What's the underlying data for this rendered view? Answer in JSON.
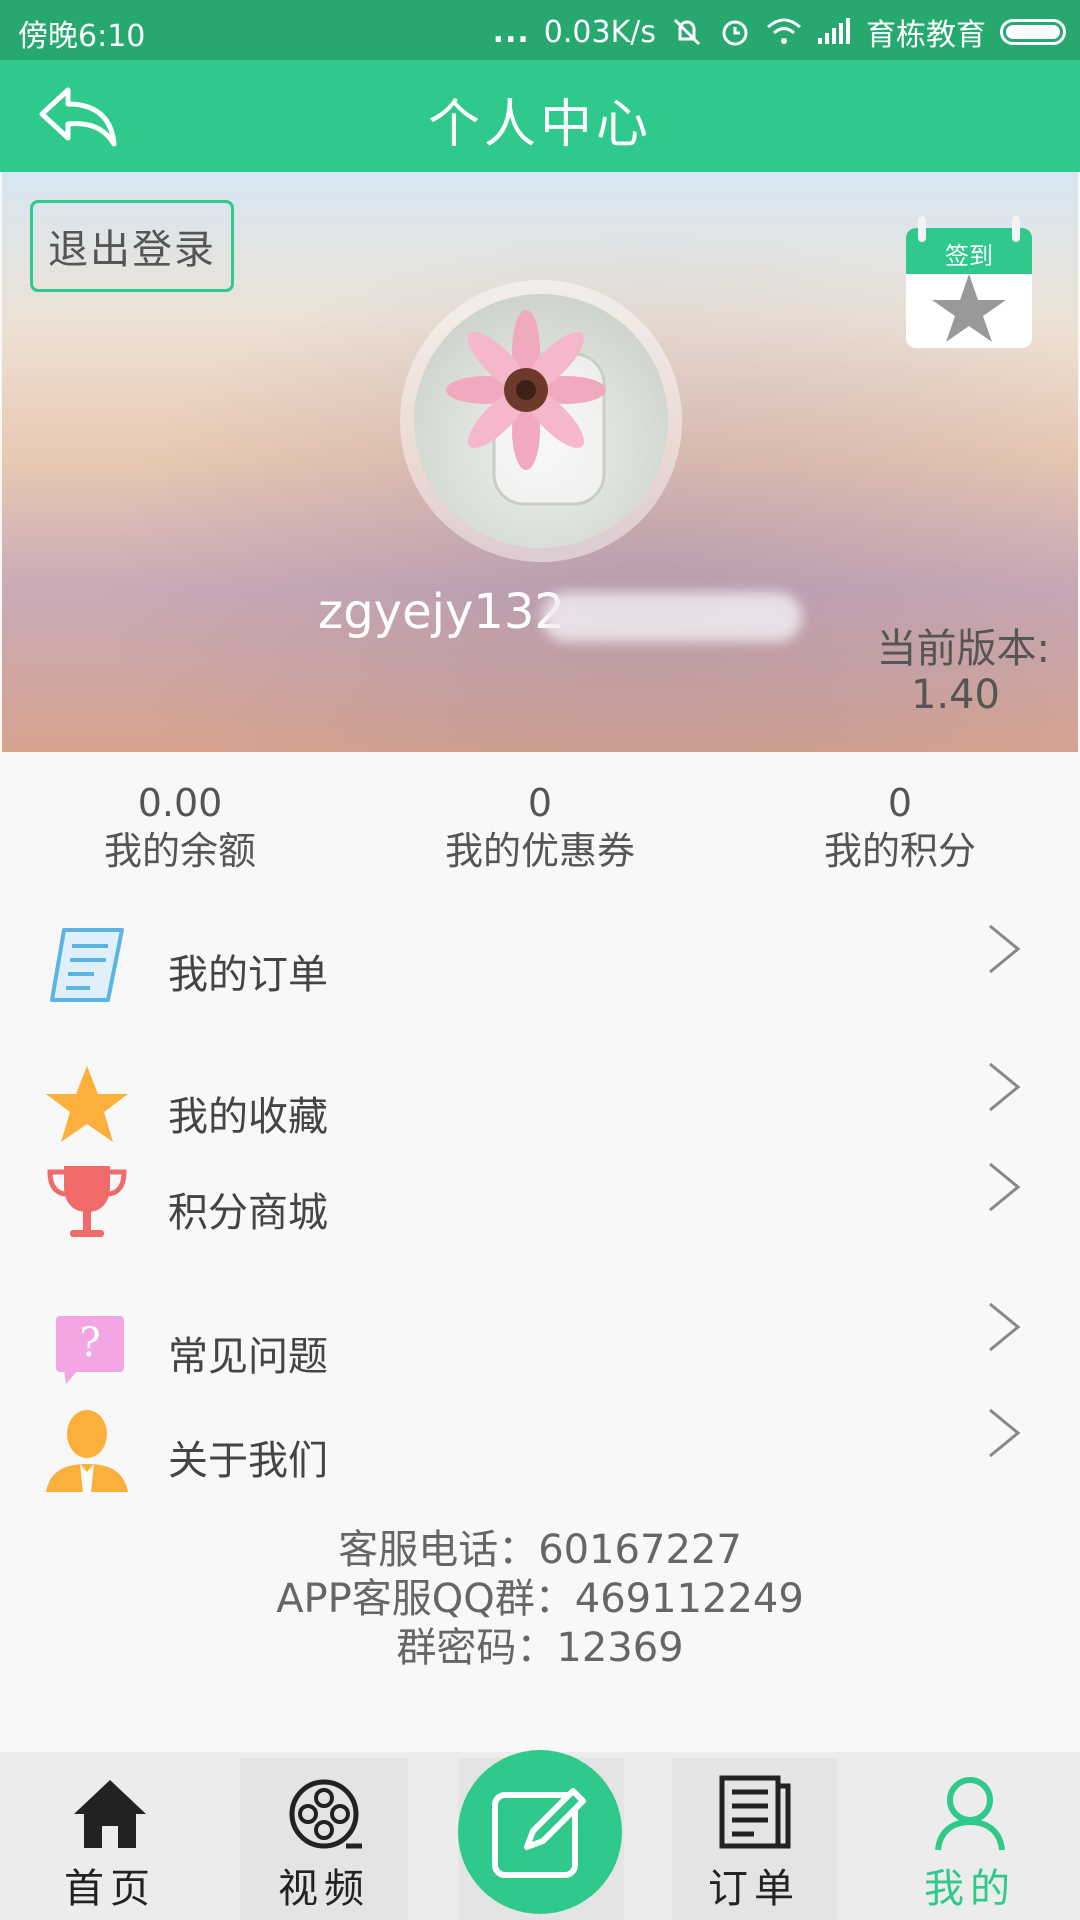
{
  "status_bar": {
    "time": "傍晚6:10",
    "dots": "...",
    "speed": "0.03K/s",
    "carrier": "育栋教育"
  },
  "header": {
    "title": "个人中心"
  },
  "profile": {
    "logout_label": "退出登录",
    "signin_label": "签到",
    "username": "zgyejy132",
    "version_label": "当前版本:",
    "version_value": "1.40"
  },
  "stats": [
    {
      "value": "0.00",
      "label": "我的余额"
    },
    {
      "value": "0",
      "label": "我的优惠券"
    },
    {
      "value": "0",
      "label": "我的积分"
    }
  ],
  "menu": [
    {
      "label": "我的订单",
      "icon": "order-list-icon"
    },
    {
      "label": "我的收藏",
      "icon": "star-icon"
    },
    {
      "label": "积分商城",
      "icon": "trophy-icon"
    },
    {
      "label": "常见问题",
      "icon": "question-icon"
    },
    {
      "label": "关于我们",
      "icon": "person-icon"
    }
  ],
  "contact": {
    "phone": "客服电话：60167227",
    "qq_group": "APP客服QQ群：469112249",
    "group_password": "群密码：12369"
  },
  "bottom_nav": [
    {
      "label": "首页",
      "icon": "home-icon"
    },
    {
      "label": "视频",
      "icon": "film-reel-icon"
    },
    {
      "label": "",
      "icon": "edit-icon"
    },
    {
      "label": "订单",
      "icon": "document-icon"
    },
    {
      "label": "我的",
      "icon": "user-icon"
    }
  ],
  "colors": {
    "primary": "#2ec98b",
    "status_bar": "#26a86f",
    "active_tab": "#2ec98b"
  }
}
